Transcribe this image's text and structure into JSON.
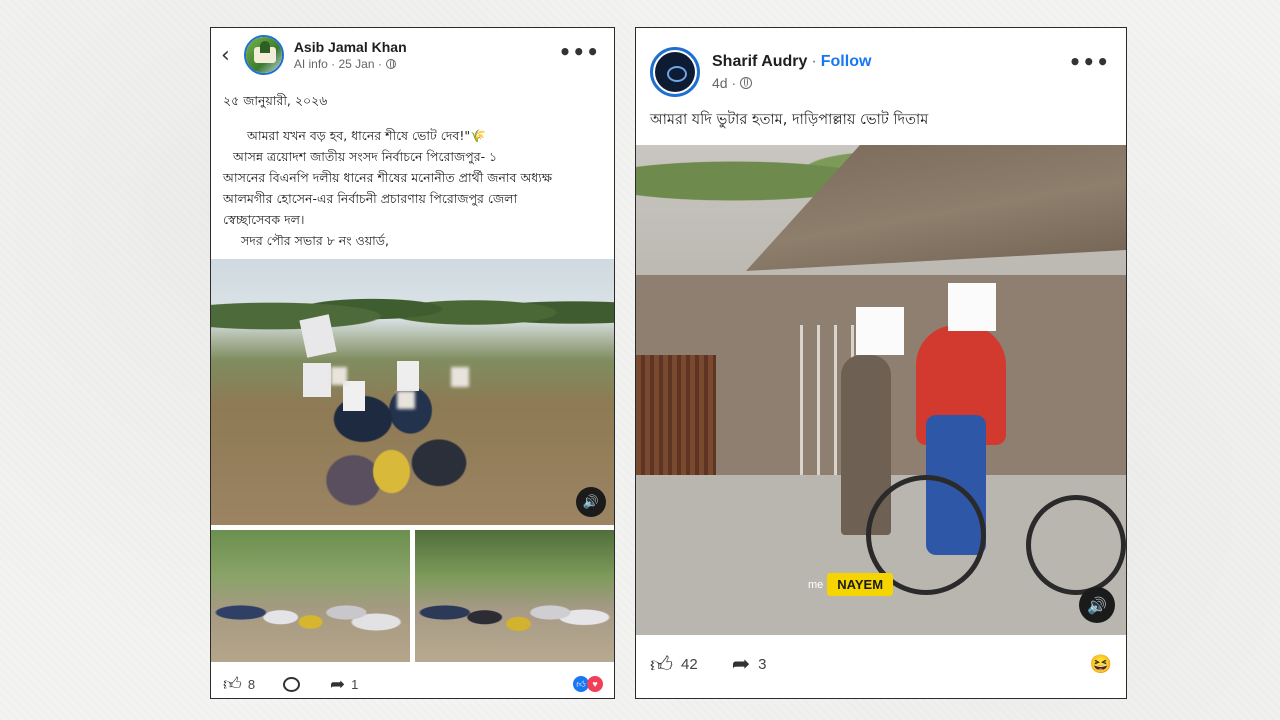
{
  "left_post": {
    "author": "Asib Jamal Khan",
    "meta": "AI info · 25 Jan ·",
    "date_line": "২৫ জানুয়ারী, ২০২৬",
    "lines": [
      "আমরা যখন বড় হব, ধানের শীষে ভোট দেব!\"🌾",
      "আসন্ন ত্রয়োদশ জাতীয় সংসদ নির্বাচনে পিরোজপুর- ১",
      "আসনের বিএনপি দলীয় ধানের শীষের মনোনীত প্রার্থী জনাব অধ্যক্ষ",
      "আলমগীর হোসেন-এর নির্বাচনী প্রচারণায় পিরোজপুর জেলা",
      "স্বেচ্ছাসেবক দল।",
      "সদর পৌর সভার ৮ নং ওয়ার্ড,"
    ],
    "likes": "8",
    "shares": "1",
    "reaction_colors": [
      "#1877f2",
      "#f33e58"
    ]
  },
  "right_post": {
    "author": "Sharif Audry",
    "follow": "Follow",
    "time": "4d ·",
    "caption": "আমরা যদি ভুটার হতাম, দাড়িপাল্লায় ভোট দিতাম",
    "watermark_prefix": "me",
    "watermark": "NAYEM",
    "likes": "42",
    "shares": "3",
    "reaction_emoji": "😆"
  }
}
